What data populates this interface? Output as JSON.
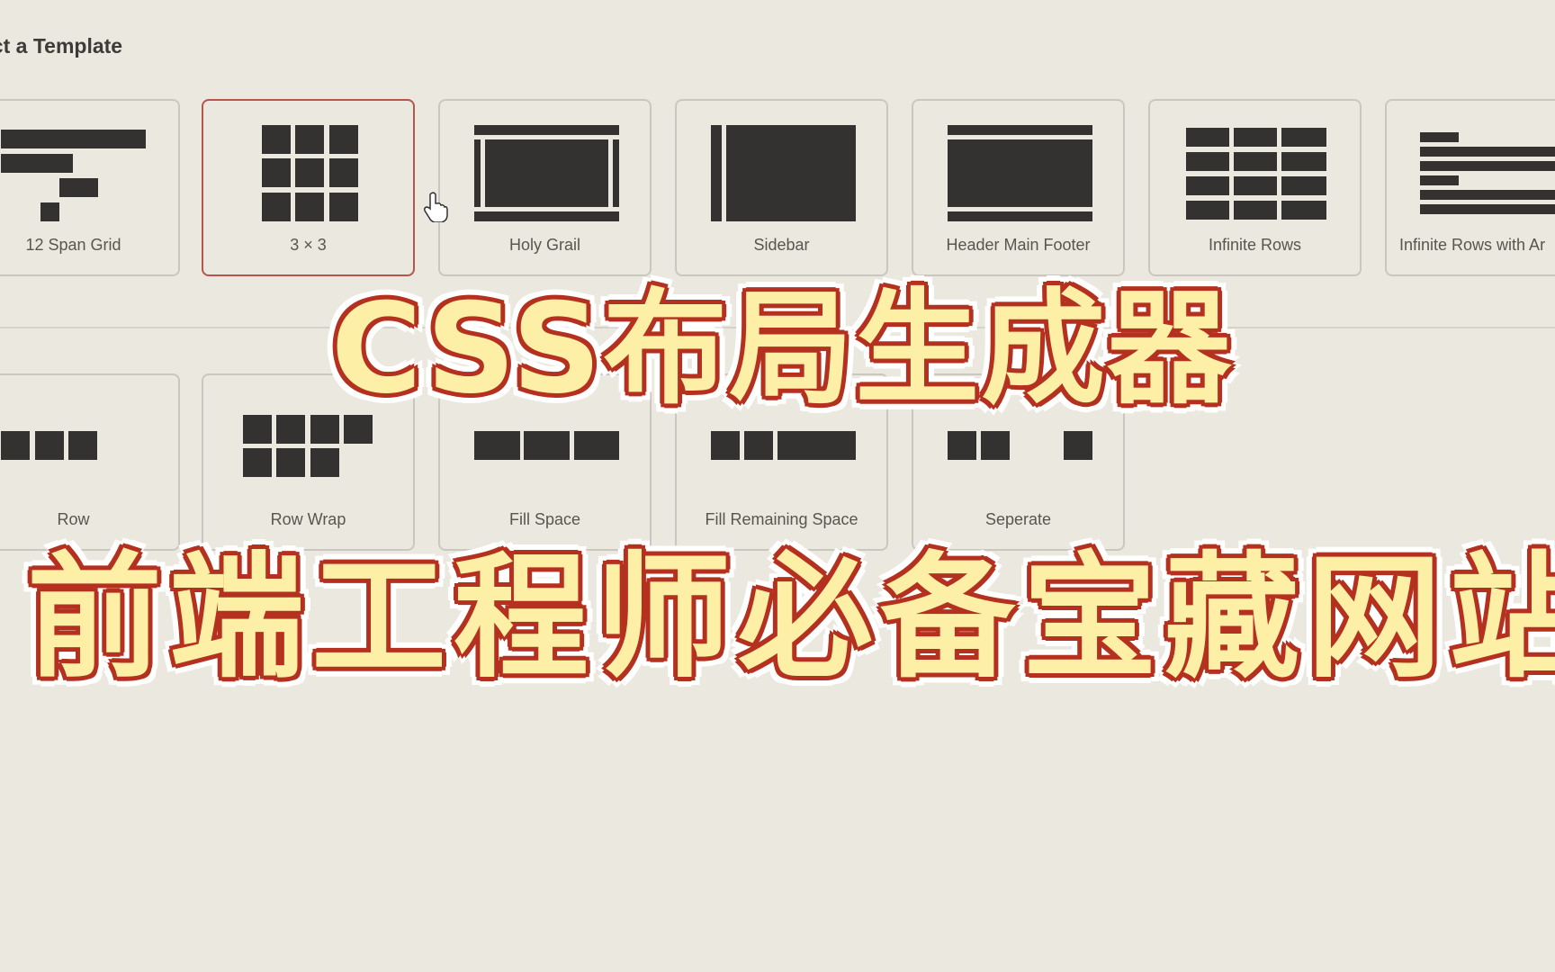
{
  "heading": "ect a Template",
  "templates_row1": [
    {
      "label": "12 Span Grid",
      "icon": "twelve-span-grid-icon",
      "selected": false
    },
    {
      "label": "3 × 3",
      "icon": "three-by-three-grid-icon",
      "selected": true
    },
    {
      "label": "Holy Grail",
      "icon": "holy-grail-layout-icon",
      "selected": false
    },
    {
      "label": "Sidebar",
      "icon": "sidebar-layout-icon",
      "selected": false
    },
    {
      "label": "Header Main Footer",
      "icon": "header-main-footer-icon",
      "selected": false
    },
    {
      "label": "Infinite Rows",
      "icon": "infinite-rows-icon",
      "selected": false
    },
    {
      "label": "Infinite Rows with Ar",
      "icon": "infinite-rows-with-areas-icon",
      "selected": false
    }
  ],
  "templates_row2": [
    {
      "label": "Row",
      "icon": "row-layout-icon"
    },
    {
      "label": "Row Wrap",
      "icon": "row-wrap-layout-icon"
    },
    {
      "label": "Fill Space",
      "icon": "fill-space-layout-icon"
    },
    {
      "label": "Fill Remaining Space",
      "icon": "fill-remaining-space-icon"
    },
    {
      "label": "Seperate",
      "icon": "separate-layout-icon"
    }
  ],
  "overlay": {
    "title_line1": "CSS布局生成器",
    "title_line2": "前端工程师必备宝藏网站"
  },
  "colors": {
    "background": "#ebe9df",
    "selected_border": "#b5564a",
    "block": "#333231",
    "overlay_fill": "#fdf0a6",
    "overlay_stroke": "#b5311f"
  }
}
